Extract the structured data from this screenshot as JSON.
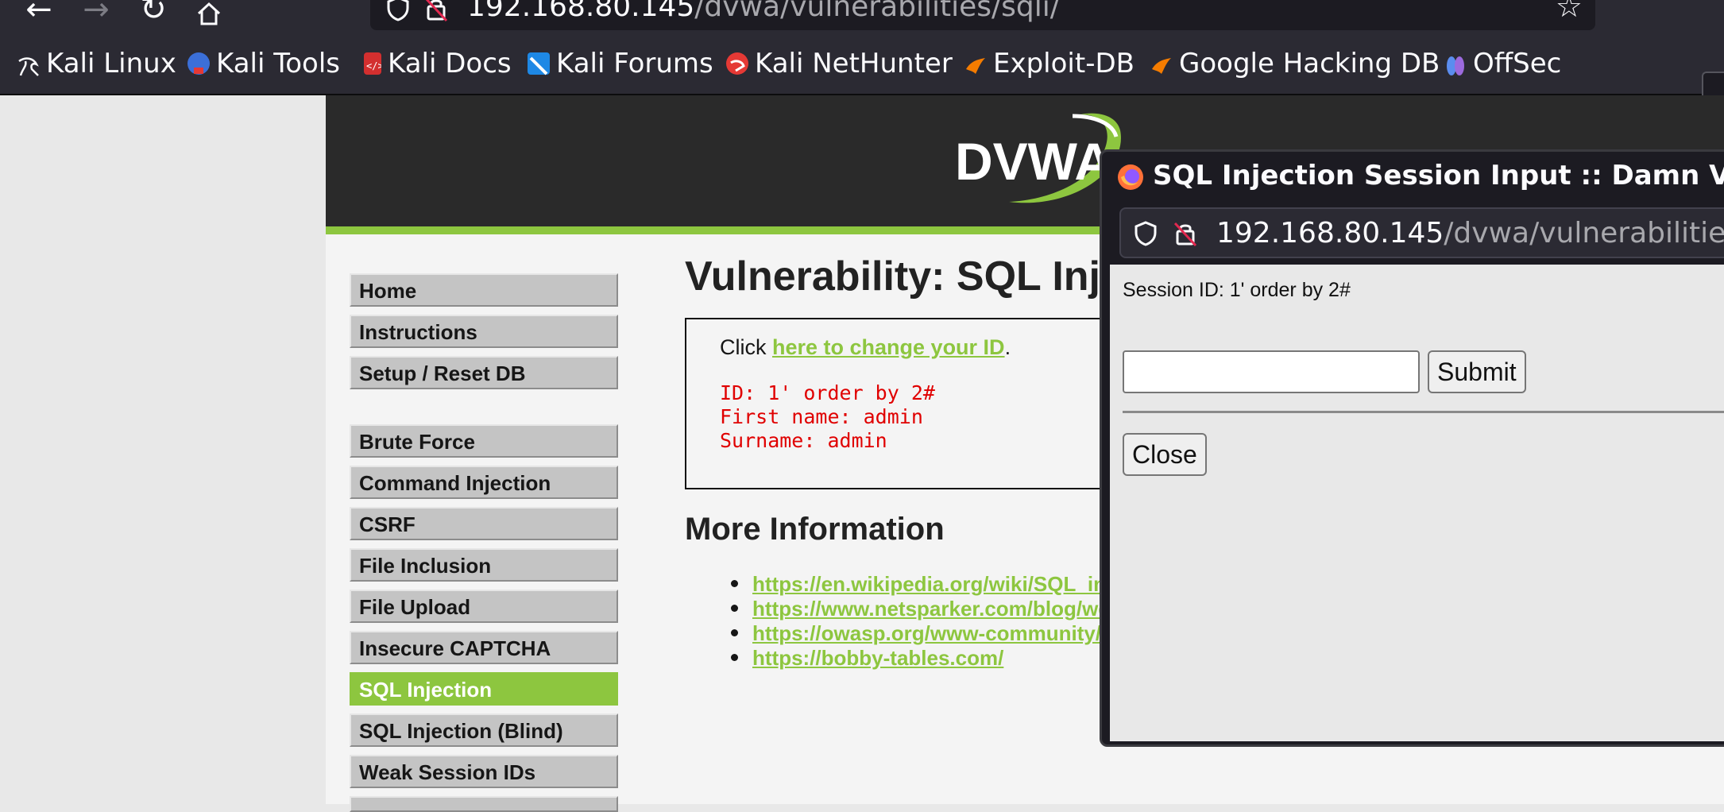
{
  "browser": {
    "url_host": "192.168.80.145",
    "url_path": "/dvwa/vulnerabilities/sqli/",
    "bookmarks": [
      {
        "label": "Kali Linux",
        "icon": "kali-dragon-icon"
      },
      {
        "label": "Kali Tools",
        "icon": "kali-tools-icon"
      },
      {
        "label": "Kali Docs",
        "icon": "kali-docs-icon"
      },
      {
        "label": "Kali Forums",
        "icon": "kali-forums-icon"
      },
      {
        "label": "Kali NetHunter",
        "icon": "kali-nethunter-icon"
      },
      {
        "label": "Exploit-DB",
        "icon": "exploit-db-icon"
      },
      {
        "label": "Google Hacking DB",
        "icon": "google-hacking-db-icon"
      },
      {
        "label": "OffSec",
        "icon": "offsec-icon"
      }
    ]
  },
  "header": {
    "logo_text": "DVWA"
  },
  "menu": {
    "items": [
      {
        "label": "Home"
      },
      {
        "label": "Instructions"
      },
      {
        "label": "Setup / Reset DB"
      },
      {
        "label": "Brute Force"
      },
      {
        "label": "Command Injection"
      },
      {
        "label": "CSRF"
      },
      {
        "label": "File Inclusion"
      },
      {
        "label": "File Upload"
      },
      {
        "label": "Insecure CAPTCHA"
      },
      {
        "label": "SQL Injection",
        "active": true
      },
      {
        "label": "SQL Injection (Blind)"
      },
      {
        "label": "Weak Session IDs"
      }
    ]
  },
  "main": {
    "title": "Vulnerability: SQL Inj",
    "click_prefix": "Click ",
    "change_id_link": "here to change your ID",
    "click_suffix": ".",
    "result": {
      "id_line": "ID: 1' order by 2#",
      "first_name_line": "First name: admin",
      "surname_line": "Surname: admin"
    },
    "more_info_heading": "More Information",
    "links": [
      "https://en.wikipedia.org/wiki/SQL_in",
      "https://www.netsparker.com/blog/we",
      "https://owasp.org/www-community/a",
      "https://bobby-tables.com/"
    ]
  },
  "popup": {
    "title": "SQL Injection Session Input :: Damn Vulnera",
    "url_host": "192.168.80.145",
    "url_path": "/dvwa/vulnerabilities/sq",
    "session_id": "Session ID: 1' order by 2#",
    "input_value": "",
    "submit_label": "Submit",
    "close_label": "Close"
  },
  "colors": {
    "accent": "#8dc63f",
    "result_red": "#e00000",
    "header_dark": "#2a2a2a"
  }
}
